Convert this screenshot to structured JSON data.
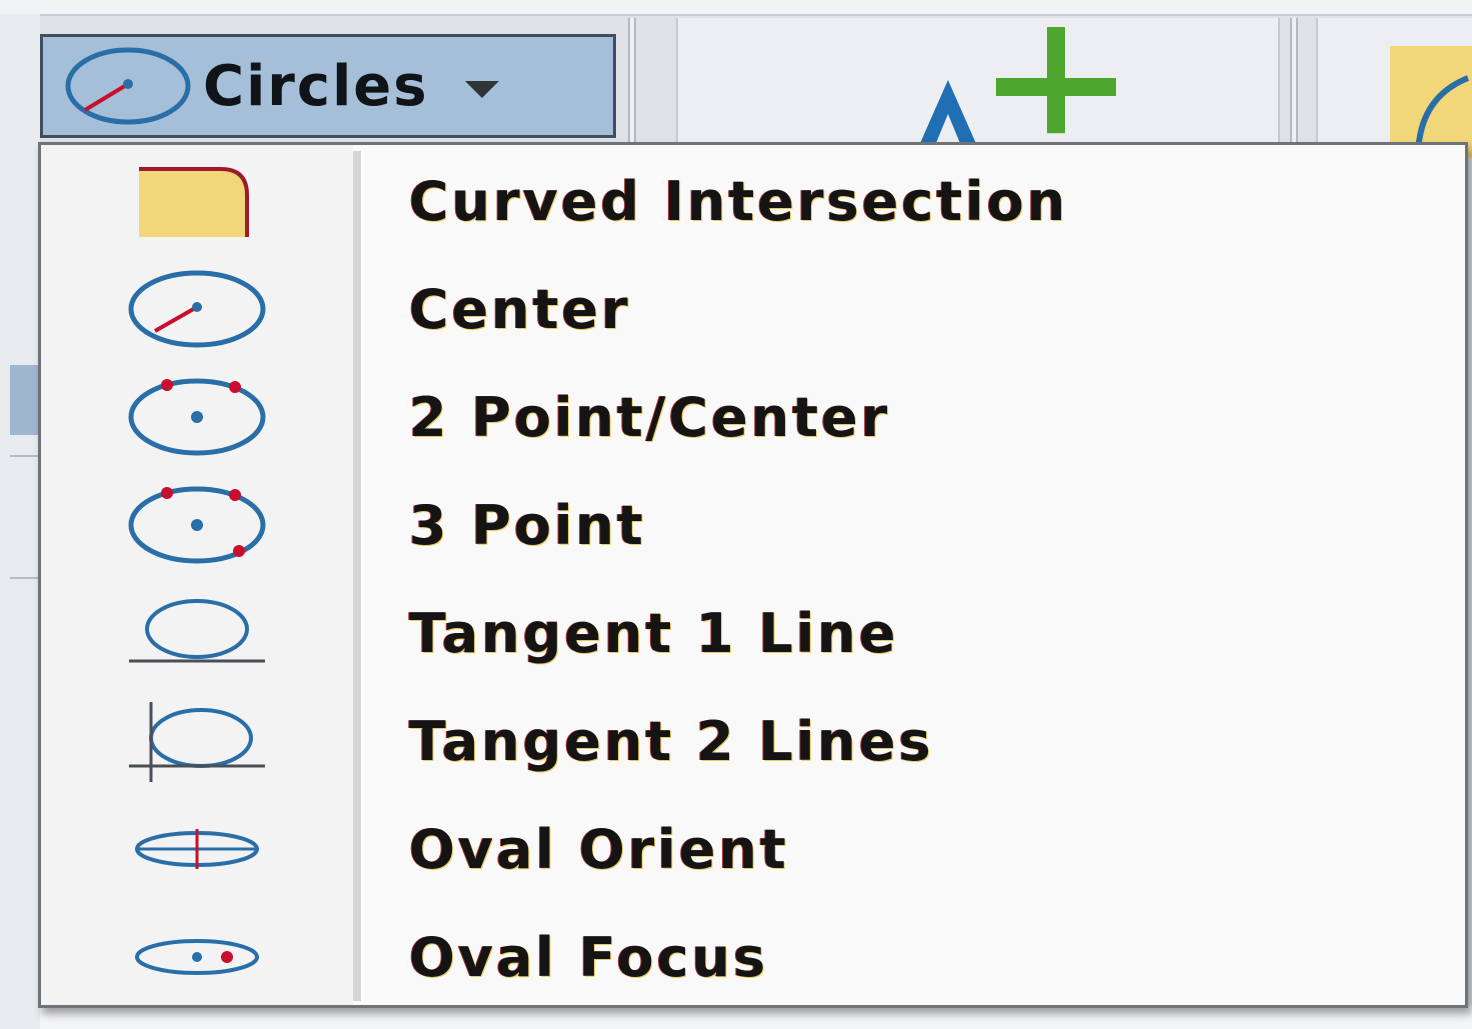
{
  "toolbar": {
    "circles_button": {
      "label": "Circles",
      "icon": "circle-center-icon",
      "dropdown_icon": "chevron-down-icon"
    },
    "text_add_button": {
      "icon": "text-add-icon"
    },
    "partial_button": {
      "icon": "arc-icon"
    }
  },
  "menu": {
    "items": [
      {
        "label": "Curved Intersection",
        "icon": "curved-intersection-icon"
      },
      {
        "label": "Center",
        "icon": "circle-center-icon"
      },
      {
        "label": "2 Point/Center",
        "icon": "circle-2-point-icon"
      },
      {
        "label": "3 Point",
        "icon": "circle-3-point-icon"
      },
      {
        "label": "Tangent 1 Line",
        "icon": "circle-tangent-1-line-icon"
      },
      {
        "label": "Tangent 2 Lines",
        "icon": "circle-tangent-2-lines-icon"
      },
      {
        "label": "Oval Orient",
        "icon": "oval-orient-icon"
      },
      {
        "label": "Oval Focus",
        "icon": "oval-focus-icon"
      }
    ]
  },
  "colors": {
    "circle_stroke": "#2a6ea8",
    "point_red": "#c8102e",
    "tab_yellow": "#f1d77a",
    "plus_green": "#4ea72e",
    "selected_button_bg": "#a5bfd9"
  }
}
